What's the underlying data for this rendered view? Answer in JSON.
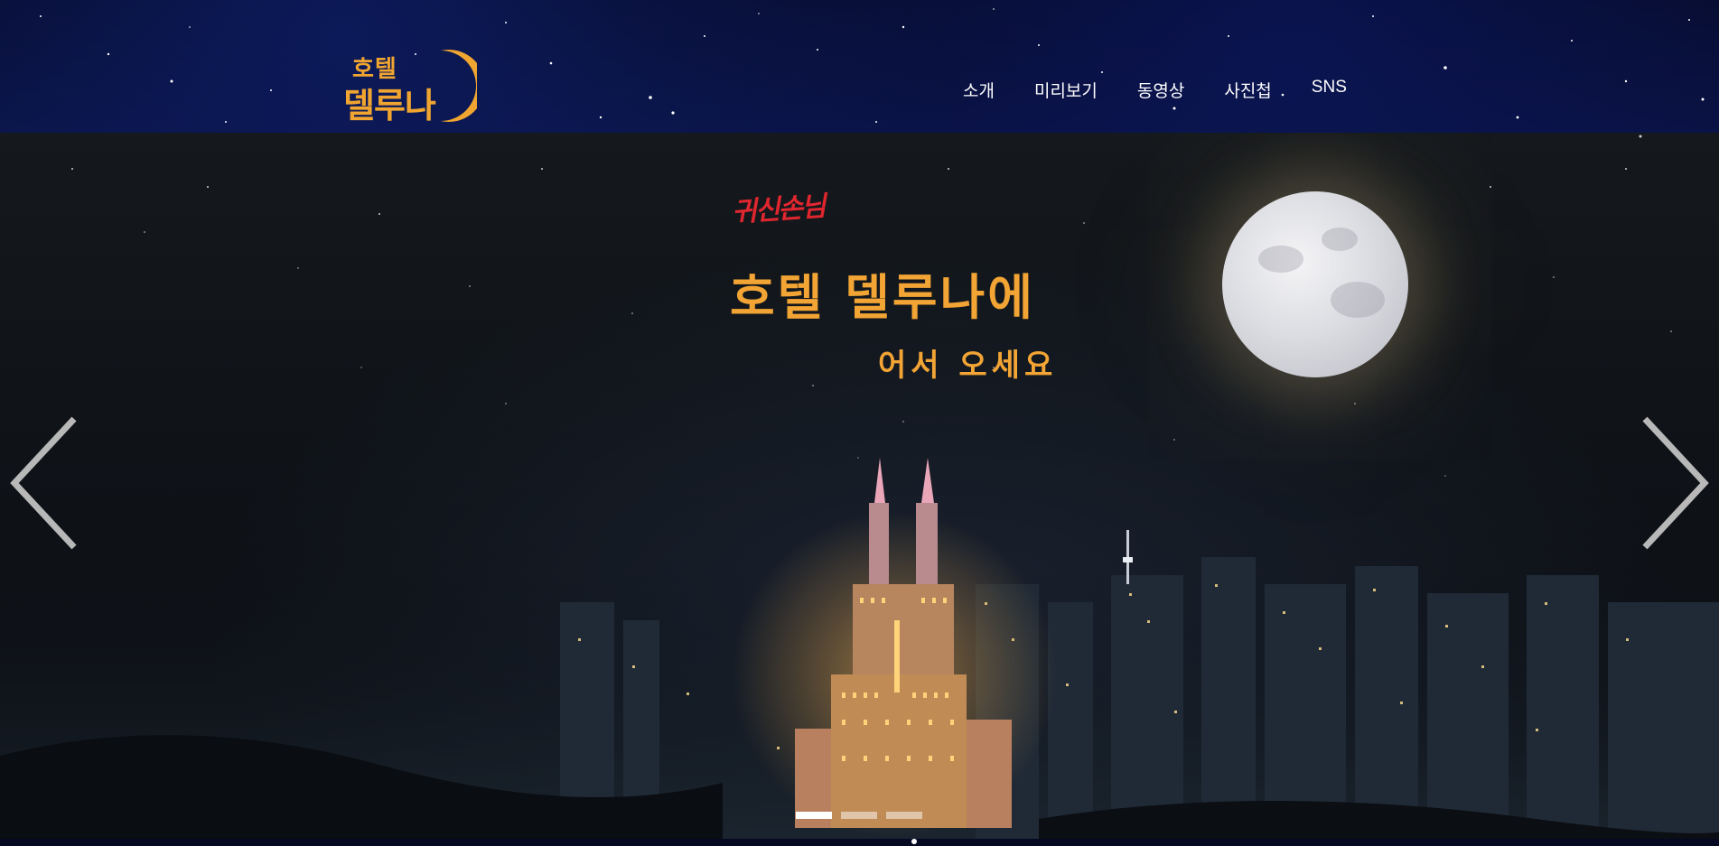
{
  "header": {
    "logo": {
      "line1": "호텔",
      "line2": "델루나"
    },
    "nav": [
      {
        "label": "소개"
      },
      {
        "label": "미리보기"
      },
      {
        "label": "동영상"
      },
      {
        "label": "사진첩"
      },
      {
        "label": "SNS"
      }
    ]
  },
  "hero": {
    "tagline_small": "귀신손님",
    "headline": "호텔 델루나에",
    "subline": "어서 오세요",
    "active_slide": 1,
    "slide_count": 3,
    "prev_icon": "chevron-left-icon",
    "next_icon": "chevron-right-icon"
  },
  "colors": {
    "brand_gold": "#f2a434",
    "tagline_red": "#e0262e",
    "header_bg": "#0a1240",
    "hero_bg": "#0f1318"
  }
}
